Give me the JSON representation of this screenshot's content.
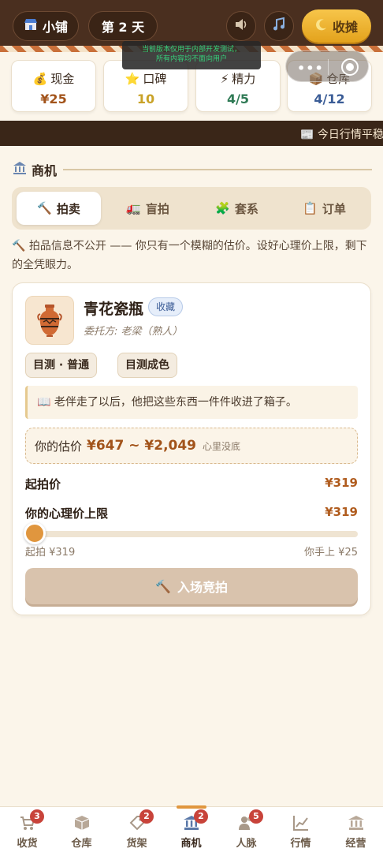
{
  "header": {
    "shop_icon": "shop-icon",
    "shop_label": "小铺",
    "day_label": "第 2 天",
    "sound_icon": "speaker-icon",
    "music_icon": "music-note-icon",
    "close_label": "收摊",
    "close_icon": "moon-icon"
  },
  "dev_notice": {
    "line1": "当前版本仅用于内部开发测试，",
    "line2": "所有内容均不面向用户"
  },
  "stats": [
    {
      "icon": "money-bag-icon",
      "label": "现金",
      "value": "¥25",
      "color": "#a2531a"
    },
    {
      "icon": "star-icon",
      "label": "口碑",
      "value": "10",
      "color": "#c9a227"
    },
    {
      "icon": "lightning-icon",
      "label": "精力",
      "value": "4/5",
      "color": "#2f7a55"
    },
    {
      "icon": "box-icon",
      "label": "仓库",
      "value": "4/12",
      "color": "#3a5c96"
    }
  ],
  "ticker": {
    "text": "📰 今日行情平稳"
  },
  "section": {
    "title": "商机",
    "icon": "bank-icon"
  },
  "tabs": [
    {
      "label": "拍卖",
      "icon": "hammer-icon",
      "active": true
    },
    {
      "label": "盲拍",
      "icon": "truck-icon",
      "active": false
    },
    {
      "label": "套系",
      "icon": "puzzle-icon",
      "active": false
    },
    {
      "label": "订单",
      "icon": "clipboard-icon",
      "active": false
    }
  ],
  "intro": "🔨 拍品信息不公开 —— 你只有一个模糊的估价。设好心理价上限，剩下的全凭眼力。",
  "item": {
    "name": "青花瓷瓶",
    "tag": "收藏",
    "consignor": "委托方: 老梁（熟人）",
    "chips": [
      "目测 · 普通",
      "目测成色"
    ],
    "quote": "📖 老伴走了以后，他把这些东西一件件收进了箱子。",
    "estimate_label": "你的估价",
    "estimate_value": "¥647 ~ ¥2,049",
    "estimate_note": "心里没底",
    "start_label": "起拍价",
    "start_value": "¥319",
    "limit_label": "你的心理价上限",
    "limit_value": "¥319",
    "slider_fraction": 0.0,
    "slider_min_label": "起拍 ¥319",
    "slider_max_label": "你手上 ¥25",
    "enter_label": "入场竞拍"
  },
  "nav": [
    {
      "label": "收货",
      "icon": "cart-icon",
      "badge": "3"
    },
    {
      "label": "仓库",
      "icon": "box-icon",
      "badge": ""
    },
    {
      "label": "货架",
      "icon": "tag-icon",
      "badge": "2"
    },
    {
      "label": "商机",
      "icon": "bank-icon",
      "badge": "2",
      "active": true
    },
    {
      "label": "人脉",
      "icon": "people-icon",
      "badge": "5"
    },
    {
      "label": "行情",
      "icon": "chart-icon",
      "badge": ""
    },
    {
      "label": "经营",
      "icon": "building-icon",
      "badge": ""
    }
  ]
}
